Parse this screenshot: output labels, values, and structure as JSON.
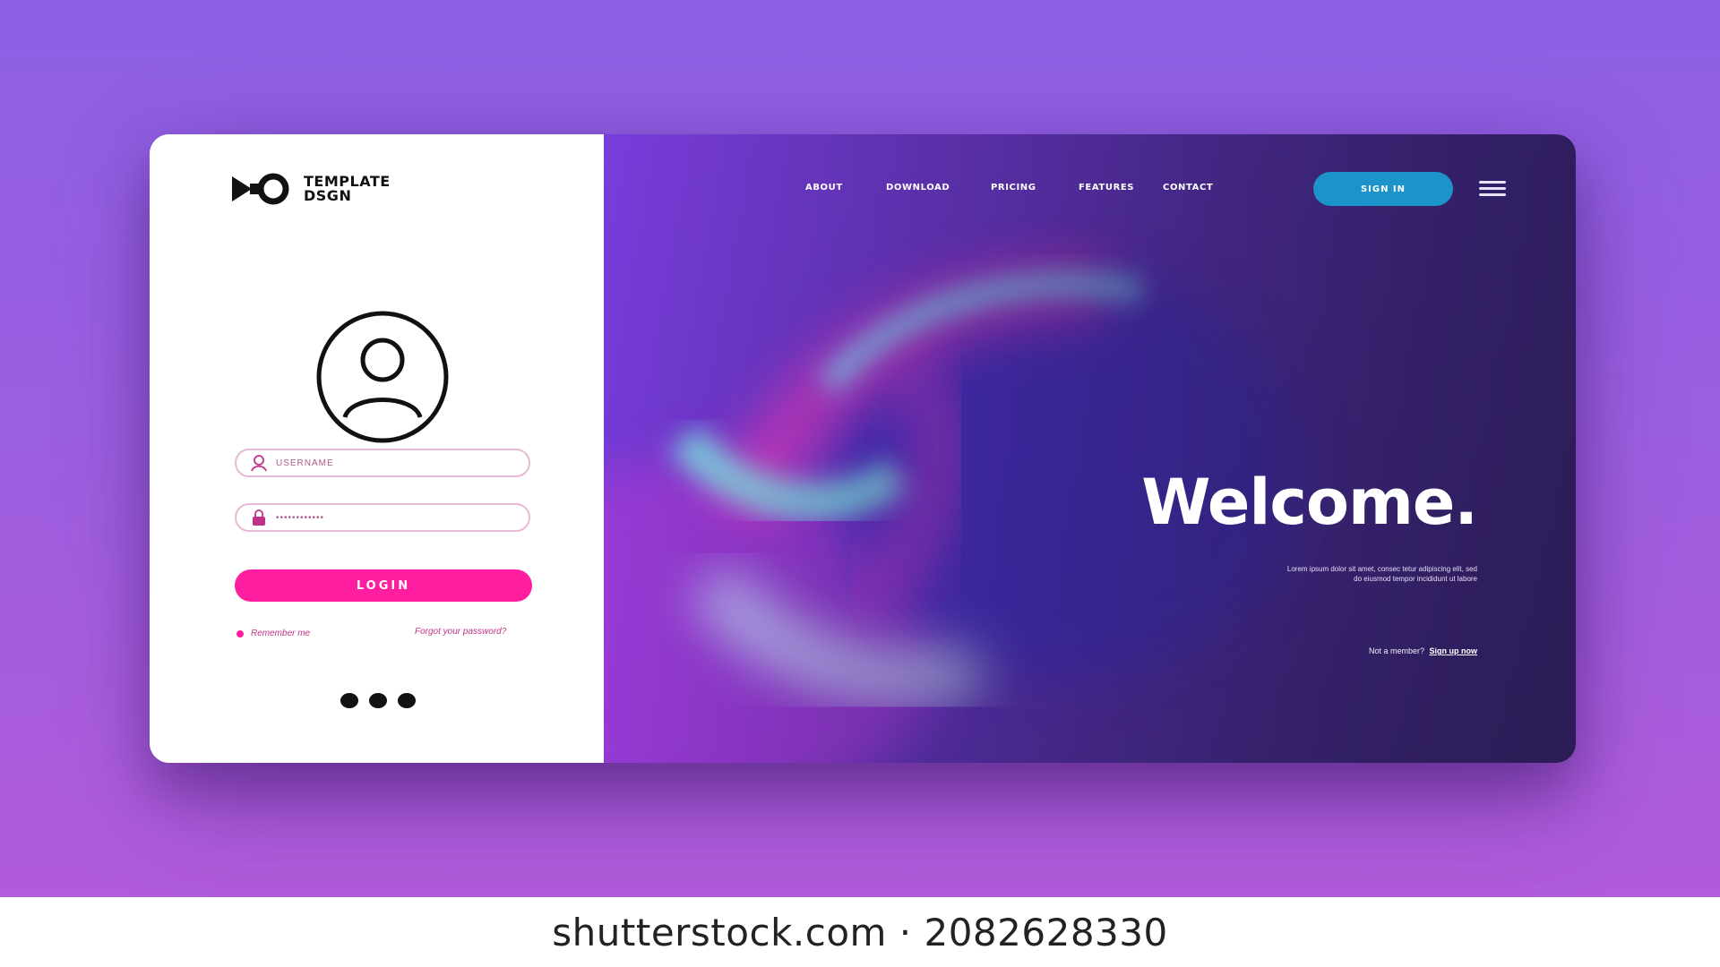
{
  "brand": {
    "name_line1": "TEMPLATE",
    "name_line2": "DSGN"
  },
  "login": {
    "username_placeholder": "USERNAME",
    "password_placeholder": "••••••••••••",
    "login_label": "LOGIN",
    "remember_label": "Remember me",
    "forgot_label": "Forgot your password?",
    "pager_dots": 3
  },
  "nav": {
    "items": [
      {
        "label": "ABOUT"
      },
      {
        "label": "DOWNLOAD"
      },
      {
        "label": "PRICING"
      },
      {
        "label": "FEATURES"
      },
      {
        "label": "CONTACT"
      }
    ],
    "signin_label": "SIGN IN"
  },
  "hero": {
    "title": "Welcome.",
    "body": "Lorem ipsum dolor sit amet, consec tetur adipiscing elit, sed do eiusmod tempor incididunt ut labore",
    "member_prompt": "Not a member?",
    "signup_label": "Sign up now"
  },
  "colors": {
    "accent_pink": "#ff1ea0",
    "accent_blue": "#1c93c9",
    "background_purple": "#8d5fe4"
  },
  "watermark": {
    "text": "shutterstock.com · 2082628330"
  },
  "icons": {
    "logo": "play-circle-logo",
    "avatar": "user-circle-icon",
    "username": "user-icon",
    "password": "lock-icon",
    "menu": "hamburger-menu-icon"
  }
}
